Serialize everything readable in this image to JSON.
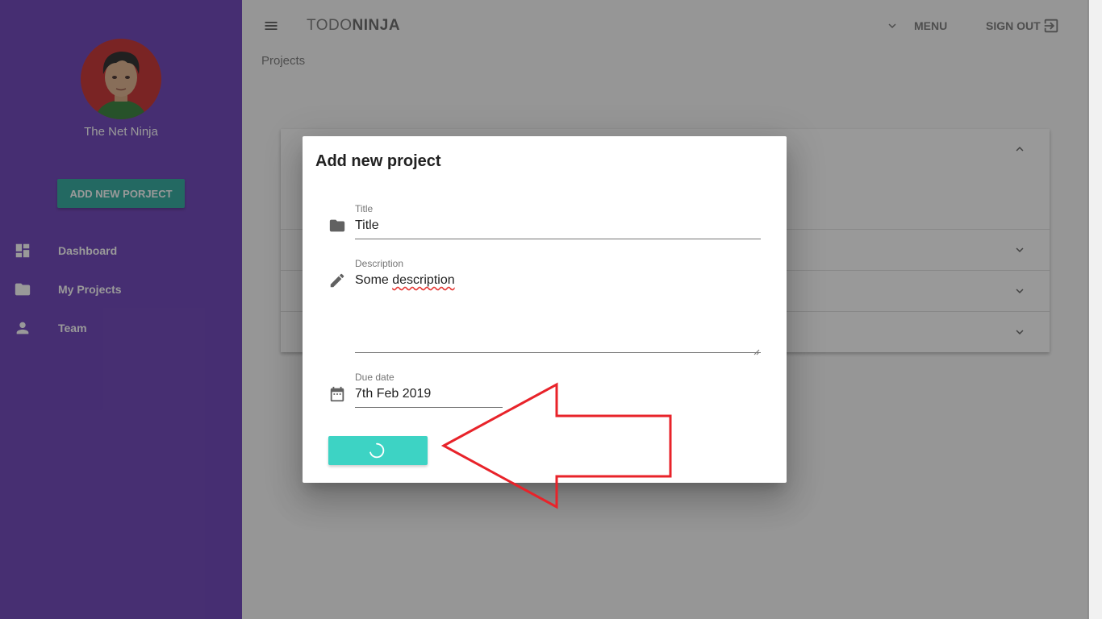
{
  "app": {
    "title_light": "TODO",
    "title_bold": "NINJA",
    "menu_label": "MENU",
    "signout_label": "SIGN OUT"
  },
  "page": {
    "subheading": "Projects"
  },
  "sidebar": {
    "user_name": "The Net Ninja",
    "add_button": "ADD NEW PORJECT",
    "items": [
      {
        "label": "Dashboard",
        "icon": "dashboard-icon"
      },
      {
        "label": "My Projects",
        "icon": "folder-icon"
      },
      {
        "label": "Team",
        "icon": "person-icon"
      }
    ]
  },
  "dialog": {
    "title": "Add new project",
    "fields": {
      "title": {
        "label": "Title",
        "value": "Title"
      },
      "description": {
        "label": "Description",
        "value_prefix": "Some ",
        "value_misspelled": "description"
      },
      "due_date": {
        "label": "Due date",
        "value": "7th Feb 2019"
      }
    },
    "submit": {
      "state": "loading"
    }
  },
  "colors": {
    "sidebar": "#673ab7",
    "accent": "#26a69a",
    "submit_loading": "#3dd3c4",
    "annotation_arrow": "#e8232a"
  }
}
